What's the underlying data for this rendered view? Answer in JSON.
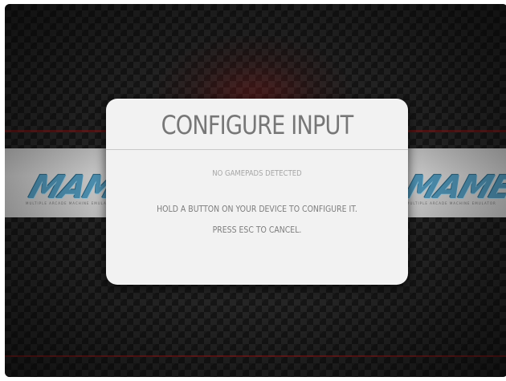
{
  "background": {
    "logo_text": "MAME",
    "logo_subtext": "MULTIPLE ARCADE MACHINE EMULATOR",
    "accent_red": "#8c1414",
    "logo_blue": "#4f94b6"
  },
  "dialog": {
    "title": "CONFIGURE INPUT",
    "subtitle": "NO GAMEPADS DETECTED",
    "instruction": "HOLD A BUTTON ON YOUR DEVICE TO CONFIGURE IT.",
    "cancel_hint": "PRESS ESC TO CANCEL."
  }
}
